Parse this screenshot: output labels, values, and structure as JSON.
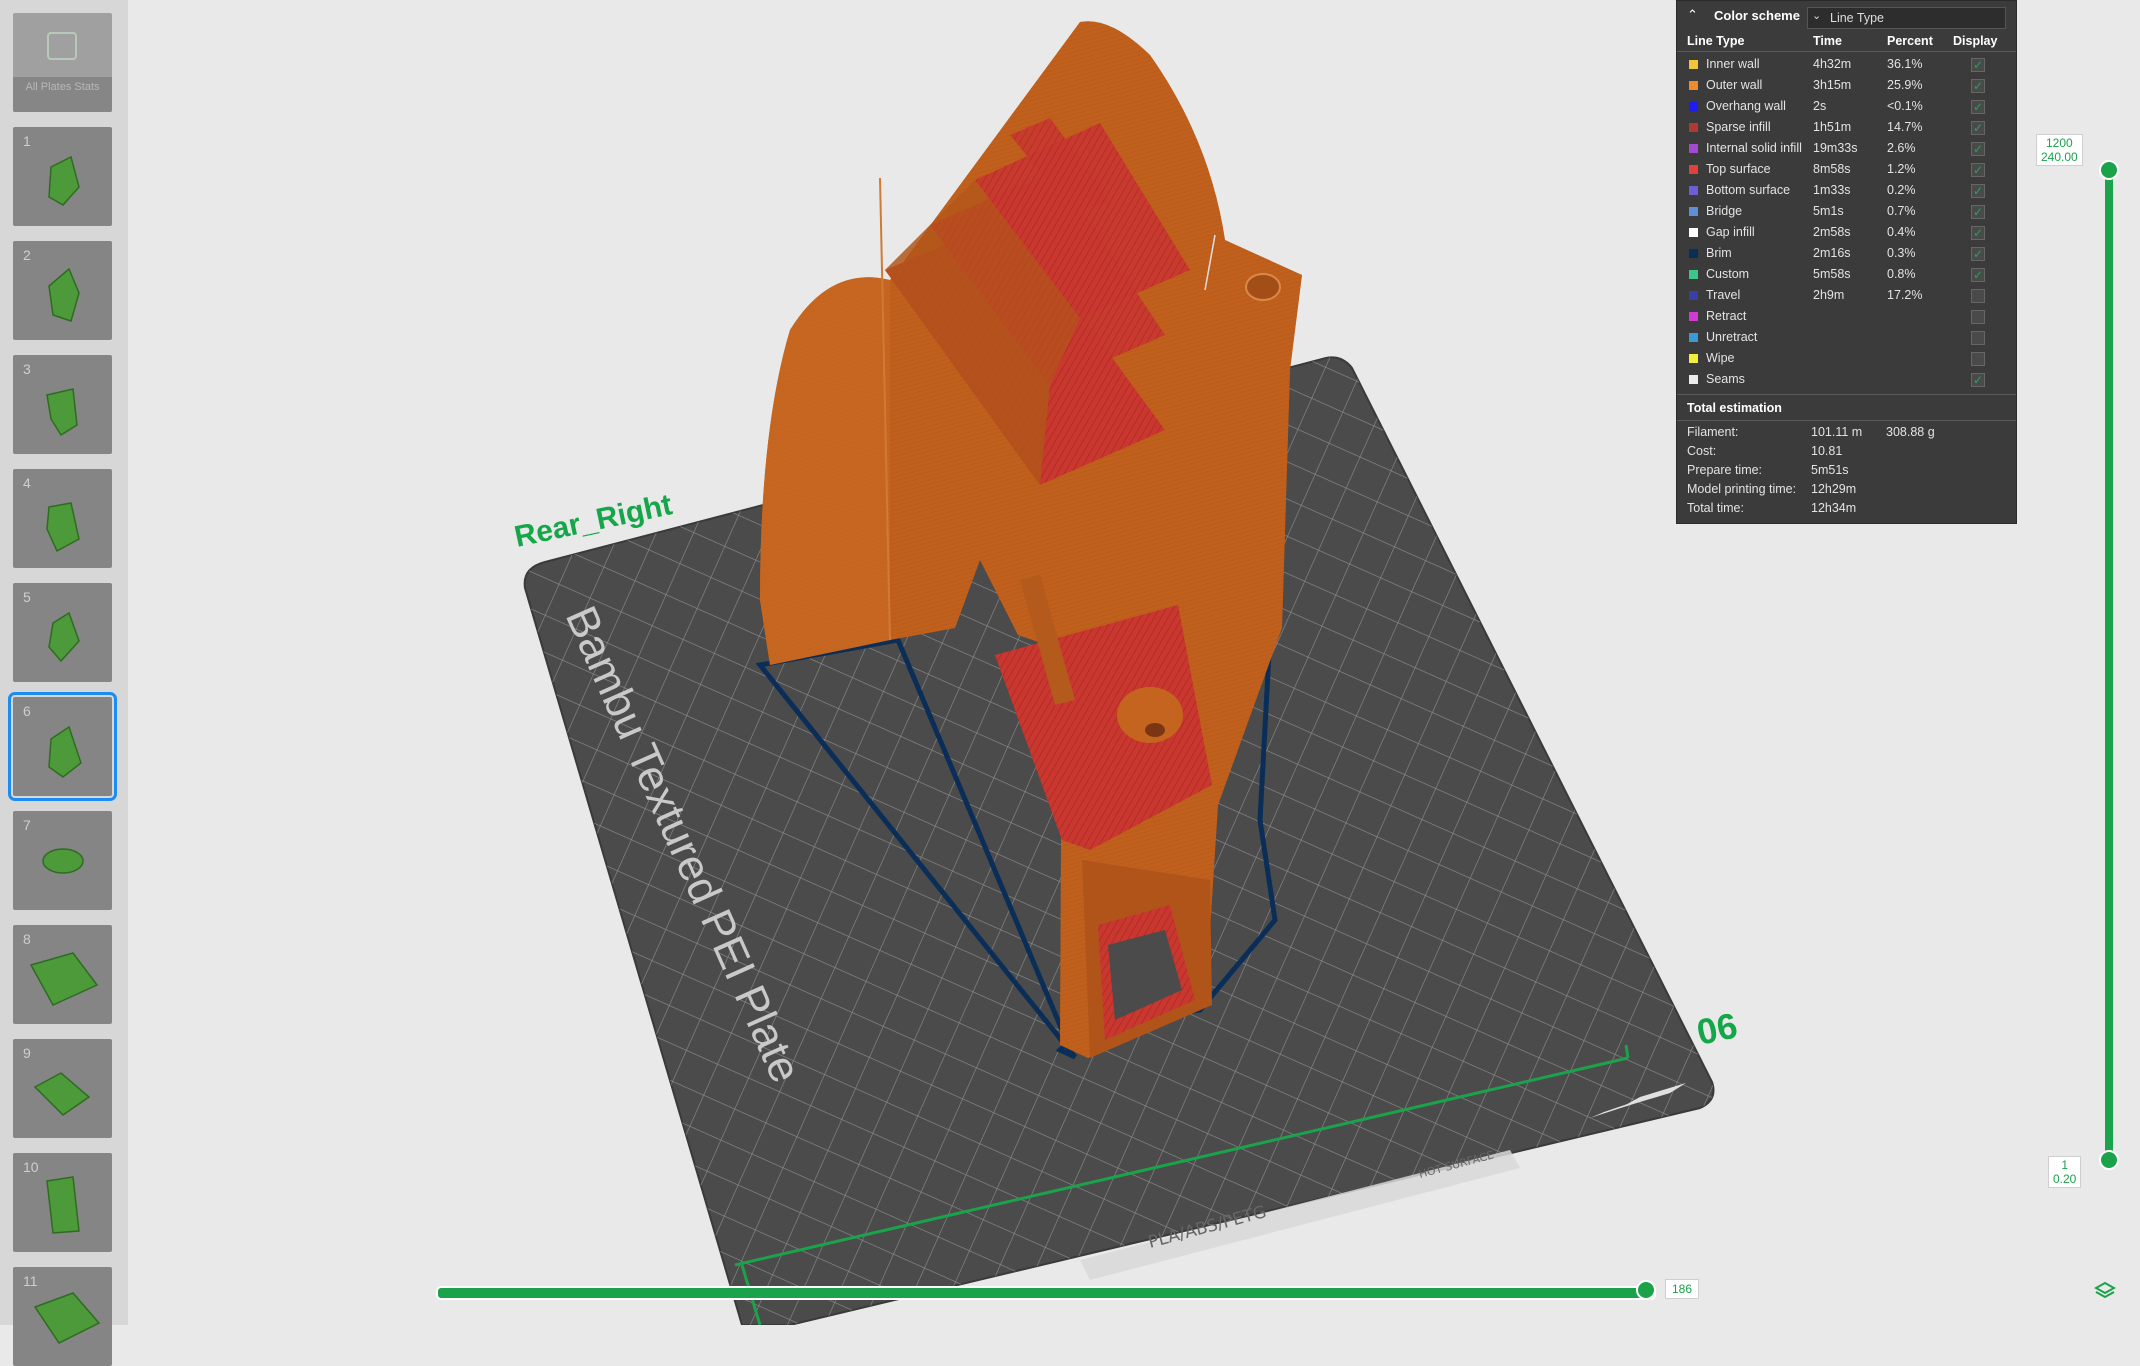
{
  "plates": {
    "all_label": "All Plates Stats",
    "items": [
      {
        "num": "1"
      },
      {
        "num": "2"
      },
      {
        "num": "3"
      },
      {
        "num": "4"
      },
      {
        "num": "5"
      },
      {
        "num": "6",
        "selected": true
      },
      {
        "num": "7"
      },
      {
        "num": "8"
      },
      {
        "num": "9"
      },
      {
        "num": "10"
      },
      {
        "num": "11"
      }
    ]
  },
  "viewport": {
    "object_name": "Rear_Right",
    "plate_number": "06",
    "bed_label": "Bambu Textured PEI Plate",
    "bed_material_text": "PLA/ABS/PETG",
    "bed_warning_text": "HOT SURFACE"
  },
  "legend": {
    "title": "Color scheme",
    "scheme_value": "Line Type",
    "columns": {
      "type": "Line Type",
      "time": "Time",
      "percent": "Percent",
      "display": "Display"
    },
    "rows": [
      {
        "name": "Inner wall",
        "time": "4h32m",
        "percent": "36.1%",
        "color": "#f2c53a",
        "checked": true
      },
      {
        "name": "Outer wall",
        "time": "3h15m",
        "percent": "25.9%",
        "color": "#f08a2c",
        "checked": true
      },
      {
        "name": "Overhang wall",
        "time": "2s",
        "percent": "<0.1%",
        "color": "#1d1df2",
        "checked": true
      },
      {
        "name": "Sparse infill",
        "time": "1h51m",
        "percent": "14.7%",
        "color": "#b03a2e",
        "checked": true
      },
      {
        "name": "Internal solid infill",
        "time": "19m33s",
        "percent": "2.6%",
        "color": "#a04bd0",
        "checked": true
      },
      {
        "name": "Top surface",
        "time": "8m58s",
        "percent": "1.2%",
        "color": "#e0413a",
        "checked": true
      },
      {
        "name": "Bottom surface",
        "time": "1m33s",
        "percent": "0.2%",
        "color": "#6c5fd6",
        "checked": true
      },
      {
        "name": "Bridge",
        "time": "5m1s",
        "percent": "0.7%",
        "color": "#5c8fd6",
        "checked": true
      },
      {
        "name": "Gap infill",
        "time": "2m58s",
        "percent": "0.4%",
        "color": "#ffffff",
        "checked": true
      },
      {
        "name": "Brim",
        "time": "2m16s",
        "percent": "0.3%",
        "color": "#0b2e58",
        "checked": true
      },
      {
        "name": "Custom",
        "time": "5m58s",
        "percent": "0.8%",
        "color": "#3fc58a",
        "checked": true
      },
      {
        "name": "Travel",
        "time": "2h9m",
        "percent": "17.2%",
        "color": "#3a3fa8",
        "checked": false
      },
      {
        "name": "Retract",
        "time": "",
        "percent": "",
        "color": "#d23ad6",
        "checked": false
      },
      {
        "name": "Unretract",
        "time": "",
        "percent": "",
        "color": "#3a9ad6",
        "checked": false
      },
      {
        "name": "Wipe",
        "time": "",
        "percent": "",
        "color": "#f2ef3a",
        "checked": false
      },
      {
        "name": "Seams",
        "time": "",
        "percent": "",
        "color": "#ececec",
        "checked": true
      }
    ],
    "total_title": "Total estimation",
    "estimation": [
      {
        "key": "Filament:",
        "value": "101.11 m",
        "value2": "308.88 g"
      },
      {
        "key": "Cost:",
        "value": "10.81",
        "value2": ""
      },
      {
        "key": "Prepare time:",
        "value": "5m51s",
        "value2": ""
      },
      {
        "key": "Model printing time:",
        "value": "12h29m",
        "value2": ""
      },
      {
        "key": "Total time:",
        "value": "12h34m",
        "value2": ""
      }
    ]
  },
  "layer_slider": {
    "top_layer": "1200",
    "top_height": "240.00",
    "bottom_layer": "1",
    "bottom_height": "0.20"
  },
  "move_slider": {
    "value": "186"
  },
  "icons": {
    "layers": "layers-icon",
    "collapse": "chevron-up-icon",
    "dropdown": "chevron-down-icon"
  },
  "colors": {
    "accent": "#1aa34a",
    "part": "#c0601c",
    "top_surface": "#c73a30",
    "bed": "#4a4a4a",
    "grid": "#8a8a8a"
  }
}
